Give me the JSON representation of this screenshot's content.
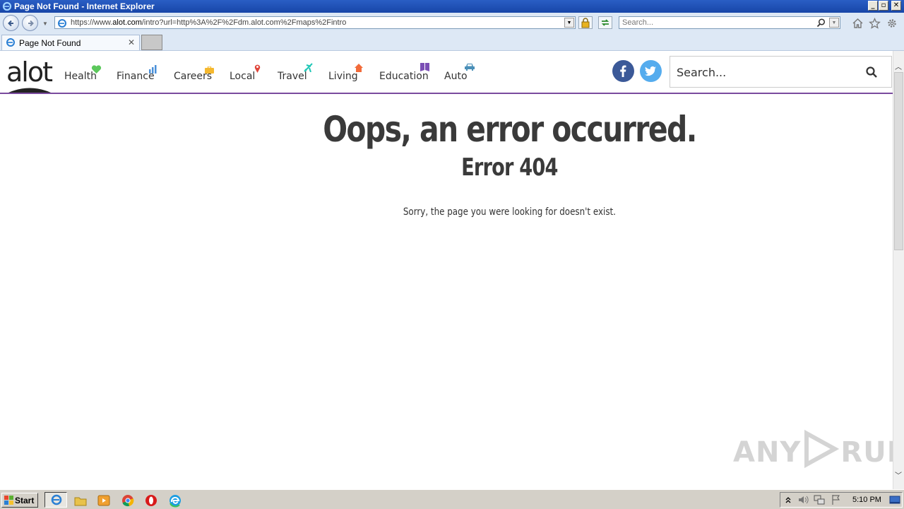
{
  "window": {
    "title": "Page Not Found - Internet Explorer"
  },
  "address_bar": {
    "url_prefix": "https://www.",
    "url_host": "alot.com",
    "url_path": "/intro?url=http%3A%2F%2Fdm.alot.com%2Fmaps%2Fintro"
  },
  "browser_search": {
    "placeholder": "Search..."
  },
  "tab": {
    "label": "Page Not Found"
  },
  "site": {
    "logo": "alot",
    "nav": [
      {
        "label": "Health",
        "icon": "heart-icon",
        "color": "#5cc85c"
      },
      {
        "label": "Finance",
        "icon": "bar-chart-icon",
        "color": "#4a90d9"
      },
      {
        "label": "Careers",
        "icon": "briefcase-icon",
        "color": "#f5b82e"
      },
      {
        "label": "Local",
        "icon": "map-pin-icon",
        "color": "#e0453a"
      },
      {
        "label": "Travel",
        "icon": "airplane-icon",
        "color": "#1fc7b6"
      },
      {
        "label": "Living",
        "icon": "house-icon",
        "color": "#f26b3a"
      },
      {
        "label": "Education",
        "icon": "book-icon",
        "color": "#7b4fb5"
      },
      {
        "label": "Auto",
        "icon": "car-icon",
        "color": "#4a8fb8"
      }
    ],
    "search_placeholder": "Search...",
    "accent": "#7a4b9e"
  },
  "error": {
    "title": "Oops, an error occurred.",
    "code": "Error 404",
    "message": "Sorry, the page you were looking for doesn't exist."
  },
  "watermark": {
    "left": "ANY",
    "right": "RUN"
  },
  "taskbar": {
    "start_label": "Start",
    "clock": "5:10 PM"
  }
}
